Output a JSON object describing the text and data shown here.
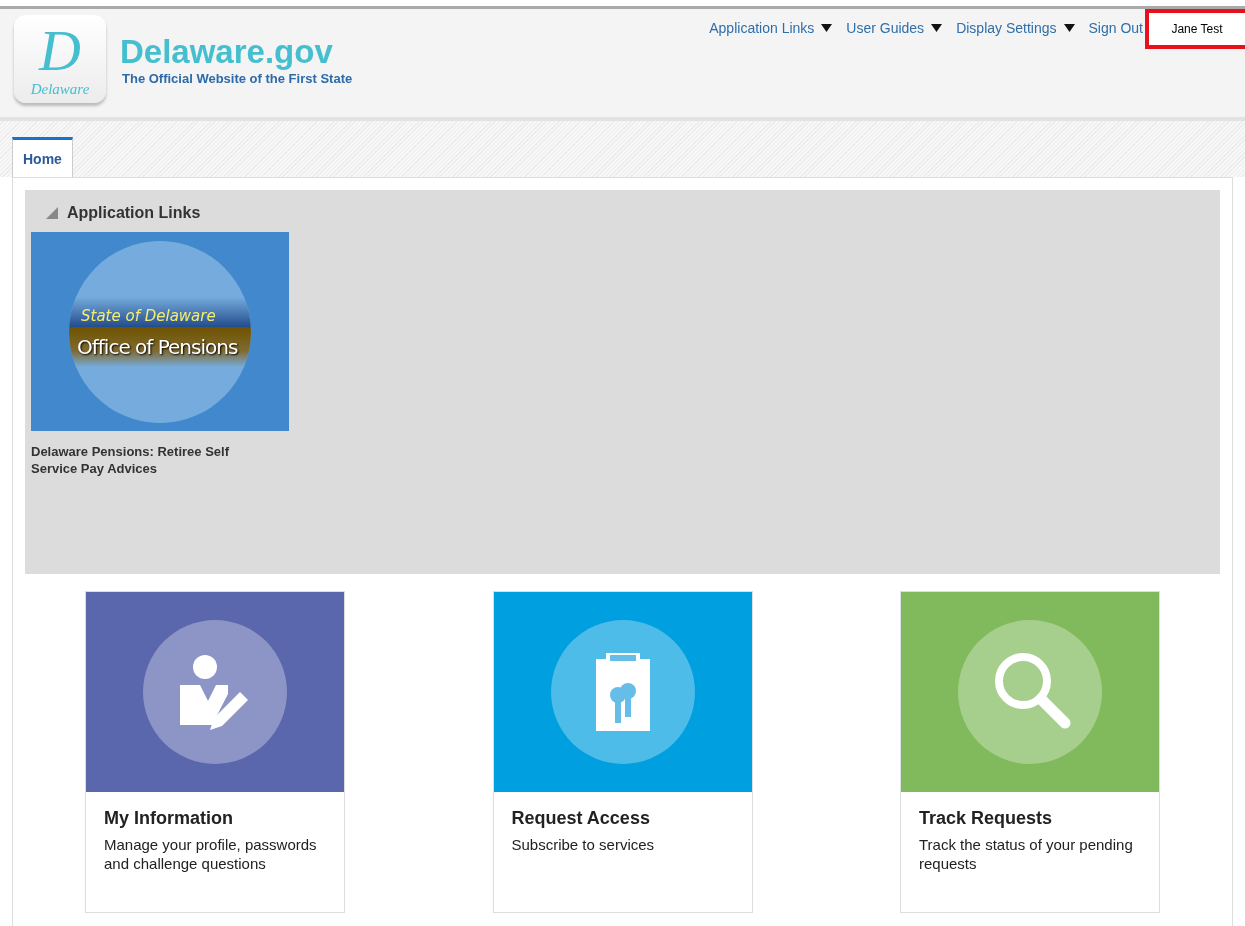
{
  "header": {
    "logo_letter": "D",
    "logo_caption": "Delaware",
    "site_title": "Delaware.gov",
    "tagline": "The Official Website of the First State"
  },
  "nav": [
    {
      "label": "Application Links",
      "dropdown": true
    },
    {
      "label": "User Guides",
      "dropdown": true
    },
    {
      "label": "Display Settings",
      "dropdown": true
    },
    {
      "label": "Sign Out",
      "dropdown": false
    }
  ],
  "user": {
    "name": "Jane Test",
    "highlighted": true
  },
  "tabs": [
    {
      "label": "Home",
      "selected": true
    }
  ],
  "application_links": {
    "title": "Application Links",
    "expanded": true,
    "items": [
      {
        "badge_top": "State of Delaware",
        "badge_main": "Office of Pensions",
        "label": "Delaware Pensions: Retiree Self Service Pay Advices"
      }
    ]
  },
  "cards": [
    {
      "kind": "person",
      "color": "#5b67ad",
      "title": "My Information",
      "description": "Manage your profile, passwords and challenge questions"
    },
    {
      "kind": "key",
      "color": "#009fdf",
      "title": "Request Access",
      "description": "Subscribe to services"
    },
    {
      "kind": "search",
      "color": "#80ba5d",
      "title": "Track Requests",
      "description": "Track the status of your pending requests"
    }
  ]
}
